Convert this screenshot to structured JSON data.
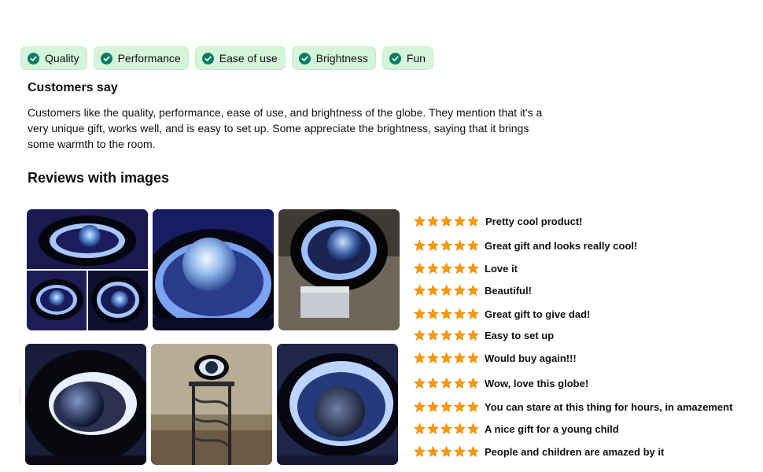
{
  "tags": [
    {
      "label": "Quality"
    },
    {
      "label": "Performance"
    },
    {
      "label": "Ease of use"
    },
    {
      "label": "Brightness"
    },
    {
      "label": "Fun"
    }
  ],
  "customers_say": {
    "title": "Customers say",
    "text": "Customers like the quality, performance, ease of use, and brightness of the globe. They mention that it's a very unique gift, works well, and is easy to set up. Some appreciate the brightness, saying that it brings some warmth to the room."
  },
  "reviews_with_images": {
    "title": "Reviews with images",
    "images": [
      {
        "icon": "floating-globe-collage-image"
      },
      {
        "icon": "floating-globe-closeup-image"
      },
      {
        "icon": "floating-globe-on-table-image"
      },
      {
        "icon": "floating-globe-dark-image"
      },
      {
        "icon": "floating-globe-on-stand-image"
      },
      {
        "icon": "floating-globe-top-view-image"
      }
    ]
  },
  "reviews": [
    {
      "rating": 5,
      "title": "Pretty cool product!"
    },
    {
      "rating": 5,
      "title": "Great gift and looks really cool!"
    },
    {
      "rating": 5,
      "title": "Love it"
    },
    {
      "rating": 5,
      "title": "Beautiful!"
    },
    {
      "rating": 5,
      "title": "Great gift to give dad!"
    },
    {
      "rating": 5,
      "title": "Easy to set up"
    },
    {
      "rating": 5,
      "title": "Would buy again!!!"
    },
    {
      "rating": 5,
      "title": "Wow, love this globe!"
    },
    {
      "rating": 5,
      "title": "You can stare at this thing for hours, in amazement"
    },
    {
      "rating": 5,
      "title": "A nice gift for a young child"
    },
    {
      "rating": 5,
      "title": "People and children are amazed by it"
    }
  ],
  "colors": {
    "tag_bg": "#d4f5da",
    "check": "#067d62",
    "star": "#ff9900"
  }
}
